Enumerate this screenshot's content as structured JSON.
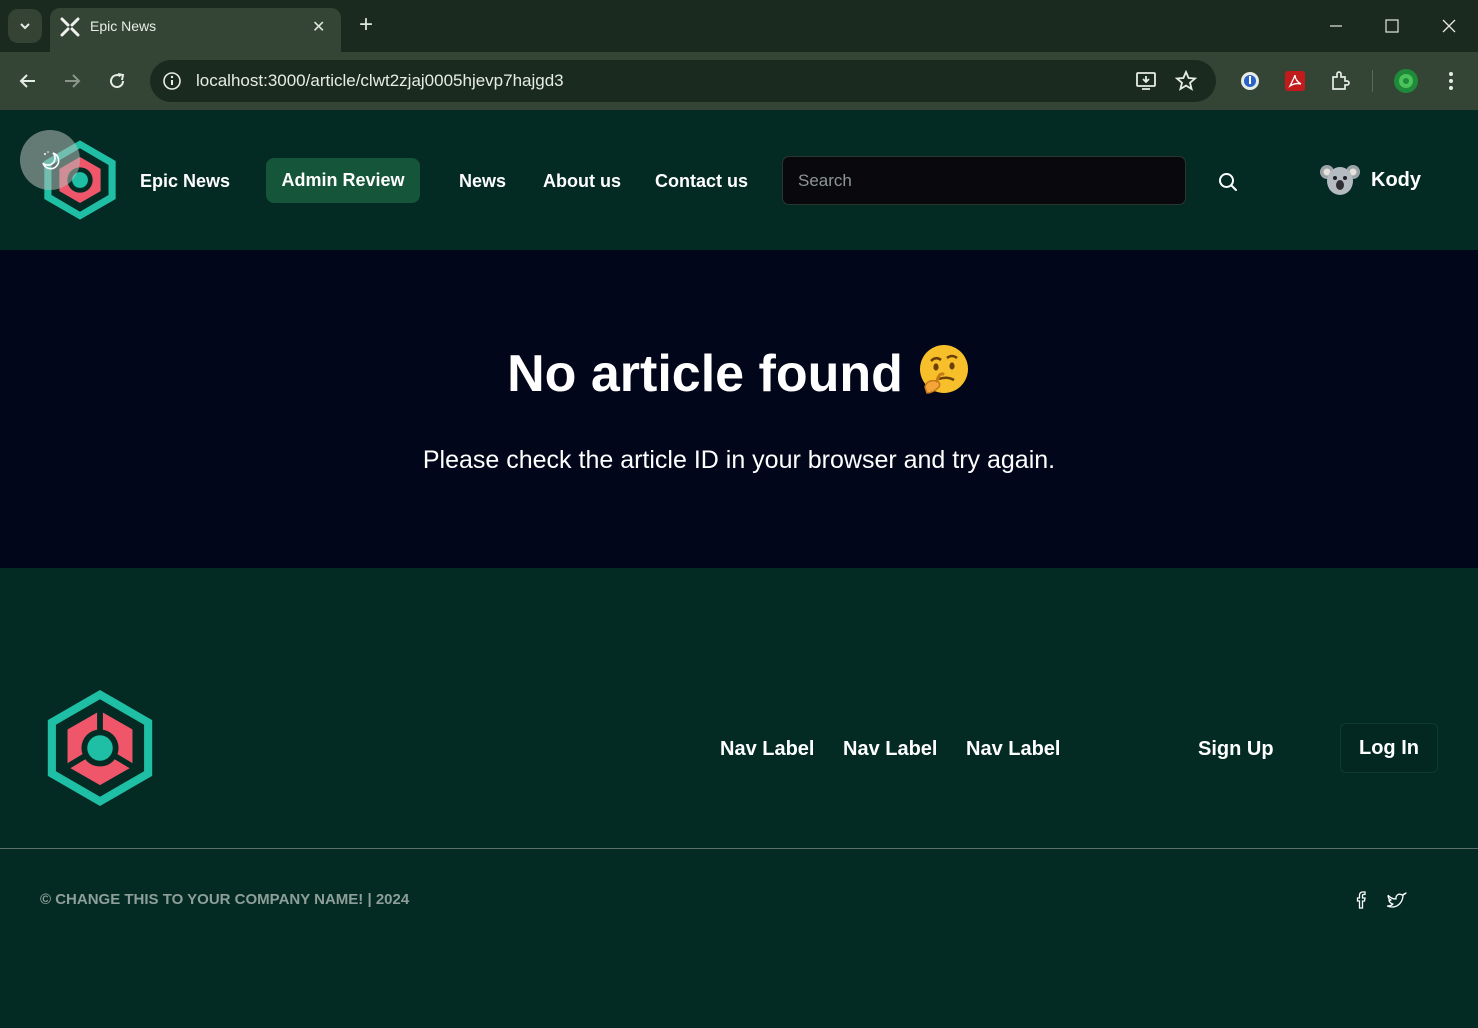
{
  "browser": {
    "tab_title": "Epic News",
    "url": "localhost:3000/article/clwt2zjaj0005hjevp7hajgd3",
    "icons": [
      "tab-dropdown-icon",
      "tab-close-icon",
      "new-tab-icon",
      "minimize-icon",
      "maximize-icon",
      "window-close-icon",
      "back-icon",
      "forward-icon",
      "reload-icon",
      "site-info-icon",
      "install-app-icon",
      "bookmark-star-icon",
      "password-manager-icon",
      "pdf-extension-icon",
      "extensions-icon",
      "profile-icon",
      "menu-icon"
    ]
  },
  "header": {
    "brand": "Epic News",
    "admin_review": "Admin Review",
    "nav": [
      "News",
      "About us",
      "Contact us"
    ],
    "search_placeholder": "Search",
    "user_name": "Kody"
  },
  "main": {
    "title": "No article found",
    "message": "Please check the article ID in your browser and try again."
  },
  "footer": {
    "nav": [
      "Nav Label",
      "Nav Label",
      "Nav Label"
    ],
    "sign_up": "Sign Up",
    "log_in": "Log In",
    "copyright": "© CHANGE THIS TO YOUR COMPANY NAME! | 2024"
  },
  "colors": {
    "header_bg": "#032b23",
    "main_bg": "#02061a",
    "admin_button": "#15553a",
    "logo_teal": "#1fbfa5",
    "logo_red": "#f0566a"
  }
}
